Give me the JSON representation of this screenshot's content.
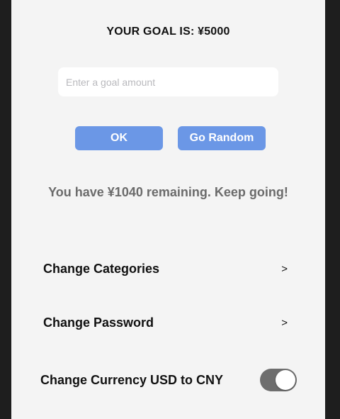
{
  "goal": {
    "title": "YOUR GOAL IS: ¥5000",
    "input_placeholder": "Enter a goal amount",
    "input_value": ""
  },
  "buttons": {
    "ok_label": "OK",
    "random_label": "Go Random"
  },
  "status": {
    "remaining_text": "You have ¥1040 remaining. Keep going!"
  },
  "settings": {
    "categories_label": "Change Categories",
    "password_label": "Change Password",
    "chevron": ">",
    "currency_label": "Change Currency USD to CNY",
    "currency_toggle_on": true
  },
  "colors": {
    "accent": "#6b97e6",
    "background": "#f4f4f4",
    "toggle_track": "#6e6e6e",
    "muted_text": "#6b6b6b"
  }
}
